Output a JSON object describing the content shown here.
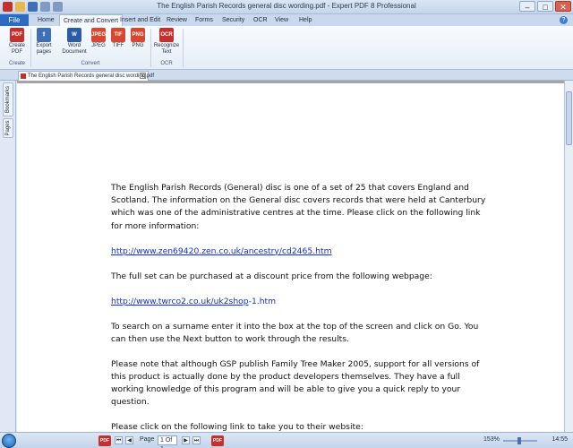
{
  "window": {
    "title": "The English Parish Records general disc wording.pdf - Expert PDF 8 Professional",
    "minimize": "–",
    "maximize": "□",
    "close": "✕"
  },
  "ribbon": {
    "file_tab": "File",
    "tabs": [
      "Home",
      "Create and Convert",
      "Insert and Edit",
      "Review",
      "Forms",
      "Security",
      "OCR",
      "View",
      "Help"
    ],
    "active_tab": "Create and Convert",
    "buttons": {
      "create_pdf": "Create PDF",
      "export_pages": "Export pages",
      "word_document": "Word Document",
      "jpeg": "JPEG",
      "tiff": "TIFF",
      "png": "PNG",
      "recognize_text": "Recognize Text"
    },
    "icon_captions": {
      "jpeg": "JPEG",
      "tiff": "TIF",
      "png": "PNG",
      "ocr": "OCR"
    },
    "groups": {
      "create": "Create",
      "convert": "Convert",
      "ocr": "OCR"
    }
  },
  "document_tab": {
    "name": "The English Parish Records general disc wording.pdf",
    "close": "x"
  },
  "side_panel": {
    "bookmarks": "Bookmarks",
    "pages": "Pages"
  },
  "document": {
    "para1": "The English Parish Records (General) disc is one of a set of 25 that covers England and Scotland. The information on the General disc covers records that were held at Canterbury which was one of the administrative centres at the time. Please click on the following link for more information:",
    "link1": "http://www.zen69420.zen.co.uk/ancestry/cd2465.htm",
    "para2": "The full set can be purchased at a discount price from the following webpage:",
    "link2_prefix": "http://www.twrco2.co.uk/uk2shop",
    "link2_suffix": "-1.htm",
    "para3": "To search on a surname enter it into the box at the top of the screen and click on Go. You can then use the Next button to work through the results.",
    "para4": "Please note that although GSP publish Family Tree Maker 2005, support for all versions of this product is actually done by the product developers themselves. They have a full working knowledge of this program and will be able to give you a quick reply to your question.",
    "para5": "Please click on the following link to take you to their website:"
  },
  "statusbar": {
    "page_label": "Page",
    "page_value": "1 Of 1",
    "zoom": "153%",
    "clock": "14:55",
    "taskbar_items": [
      "PDF",
      "PDF"
    ]
  },
  "colors": {
    "accent": "#2b6bc4",
    "link": "#1030c8",
    "pdf_red": "#c4302b"
  }
}
